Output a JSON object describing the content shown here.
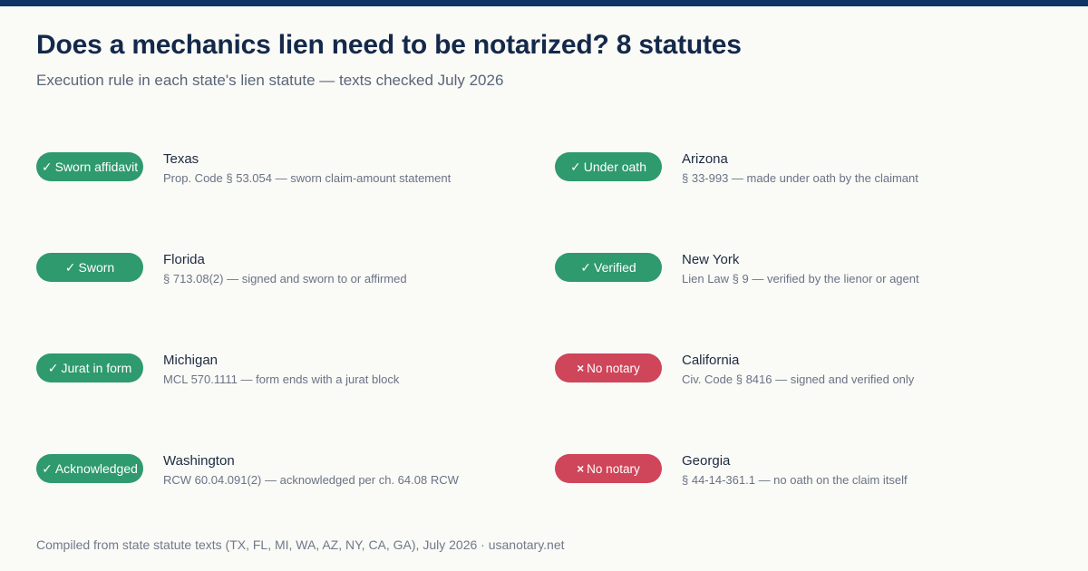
{
  "header": {
    "title": "Does a mechanics lien need to be notarized? 8 statutes",
    "subtitle": "Execution rule in each state's lien statute — texts checked July 2026"
  },
  "colors": {
    "top_bar": "#0f3565",
    "yes_badge": "#2e9a6e",
    "no_badge": "#cf4559",
    "background": "#fafaf7"
  },
  "entries": [
    {
      "status": "yes",
      "mark": "✓",
      "badge": "Sworn affidavit",
      "state": "Texas",
      "citation": "Prop. Code § 53.054 — sworn claim-amount statement"
    },
    {
      "status": "yes",
      "mark": "✓",
      "badge": "Sworn",
      "state": "Florida",
      "citation": "§ 713.08(2) — signed and sworn to or affirmed"
    },
    {
      "status": "yes",
      "mark": "✓",
      "badge": "Jurat in form",
      "state": "Michigan",
      "citation": "MCL 570.1111 — form ends with a jurat block"
    },
    {
      "status": "yes",
      "mark": "✓",
      "badge": "Acknowledged",
      "state": "Washington",
      "citation": "RCW 60.04.091(2) — acknowledged per ch. 64.08 RCW"
    },
    {
      "status": "yes",
      "mark": "✓",
      "badge": "Under oath",
      "state": "Arizona",
      "citation": "§ 33-993 — made under oath by the claimant"
    },
    {
      "status": "yes",
      "mark": "✓",
      "badge": "Verified",
      "state": "New York",
      "citation": "Lien Law § 9 — verified by the lienor or agent"
    },
    {
      "status": "no",
      "mark": "×",
      "badge": "No notary",
      "state": "California",
      "citation": "Civ. Code § 8416 — signed and verified only"
    },
    {
      "status": "no",
      "mark": "×",
      "badge": "No notary",
      "state": "Georgia",
      "citation": "§ 44-14-361.1 — no oath on the claim itself"
    }
  ],
  "footer": {
    "text": "Compiled from state statute texts (TX, FL, MI, WA, AZ, NY, CA, GA), July 2026 · usanotary.net"
  }
}
